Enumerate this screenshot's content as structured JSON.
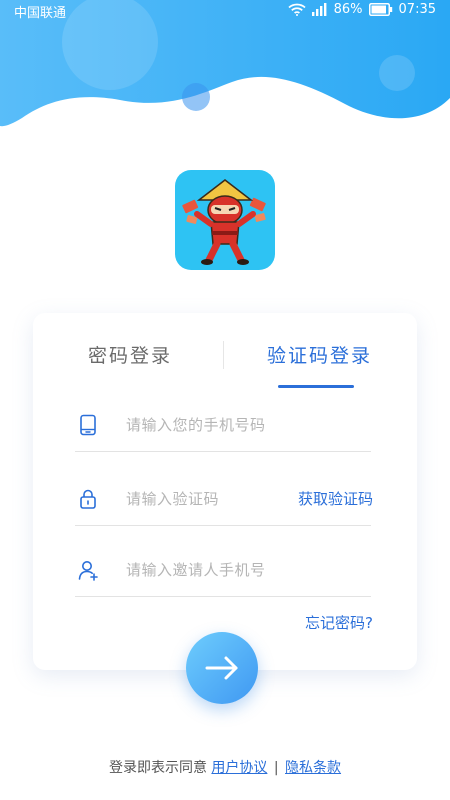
{
  "status_bar": {
    "carrier": "中国联通",
    "battery": "86%",
    "time": "07:35"
  },
  "logo": {
    "icon": "ninja-mascot-icon"
  },
  "tabs": [
    {
      "label": "密码登录",
      "active": false
    },
    {
      "label": "验证码登录",
      "active": true
    }
  ],
  "form": {
    "phone_placeholder": "请输入您的手机号码",
    "code_placeholder": "请输入验证码",
    "get_code_label": "获取验证码",
    "inviter_placeholder": "请输入邀请人手机号",
    "forgot_password": "忘记密码?"
  },
  "agreement": {
    "prefix": "登录即表示同意",
    "user_agreement": "用户协议",
    "separator": "|",
    "privacy_policy": "隐私条款"
  },
  "colors": {
    "accent": "#2b6fd9",
    "header_gradient_start": "#5ec4fd",
    "header_gradient_end": "#2a8ff0",
    "logo_background": "#2ec3f3"
  }
}
